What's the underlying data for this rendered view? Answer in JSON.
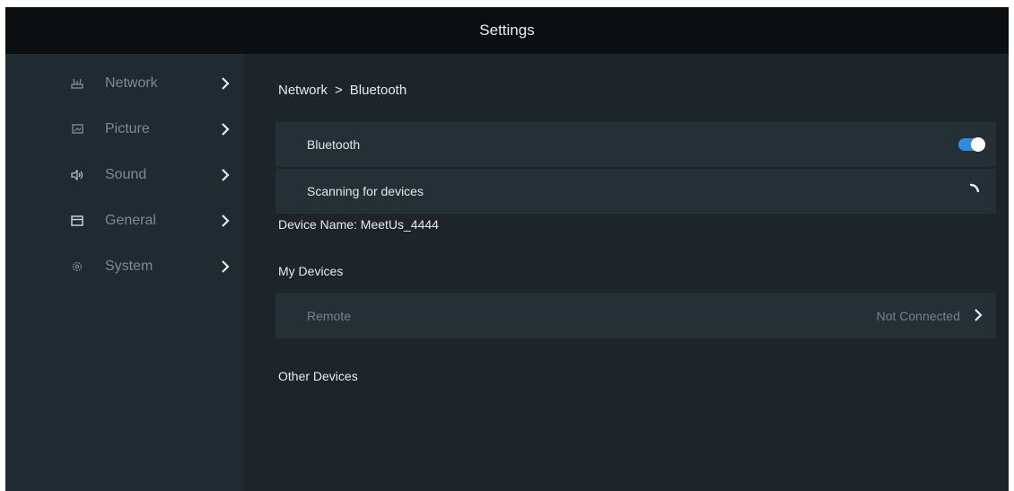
{
  "header": {
    "title": "Settings"
  },
  "sidebar": {
    "items": [
      {
        "label": "Network",
        "icon": "network-icon"
      },
      {
        "label": "Picture",
        "icon": "picture-icon"
      },
      {
        "label": "Sound",
        "icon": "speaker-icon"
      },
      {
        "label": "General",
        "icon": "general-icon"
      },
      {
        "label": "System",
        "icon": "gear-icon"
      }
    ]
  },
  "main": {
    "breadcrumb": {
      "parent": "Network",
      "separator": ">",
      "current": "Bluetooth"
    },
    "bluetooth_row": {
      "label": "Bluetooth",
      "toggle_on": true
    },
    "scanning_row": {
      "label": "Scanning for devices"
    },
    "device_name": "Device Name: MeetUs_4444",
    "my_devices": {
      "heading": "My Devices",
      "items": [
        {
          "name": "Remote",
          "status": "Not Connected"
        }
      ]
    },
    "other_devices": {
      "heading": "Other Devices"
    }
  },
  "colors": {
    "accent": "#2f8bde",
    "background": "#1d252b",
    "sidebar": "#202a31",
    "topbar": "#0c0f12"
  }
}
